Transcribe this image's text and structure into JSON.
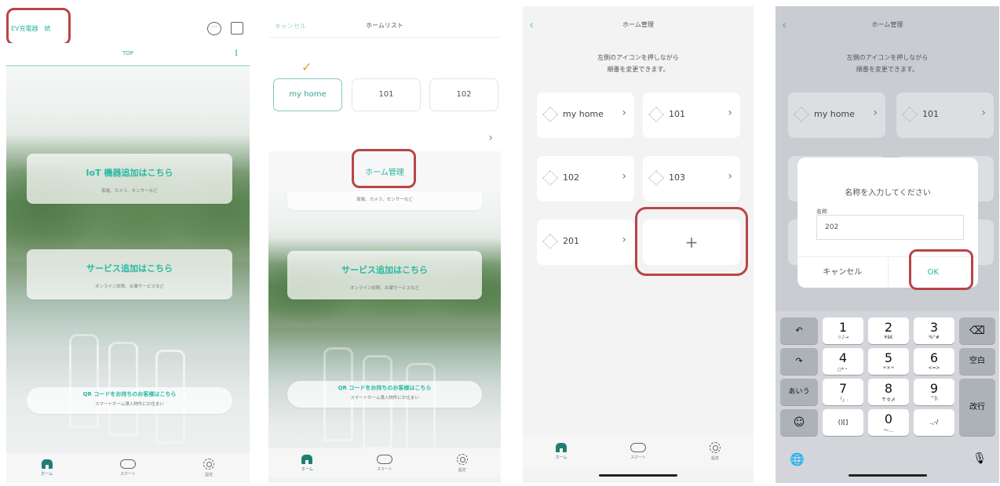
{
  "panel1": {
    "title": "EV充電器　統",
    "tab_top": "TOP",
    "card_iot": {
      "title": "IoT 機器追加はこちら",
      "sub": "家電、カメラ、センサーなど"
    },
    "card_service": {
      "title": "サービス追加はこちら",
      "sub": "オンライン診断、お薬サービスなど"
    },
    "card_qr": {
      "title": "QR コードをお持ちのお客様はこちら",
      "sub": "スマートホーム導入物件にお住まい"
    },
    "tabbar": [
      "ホーム",
      "スマート",
      "設定"
    ]
  },
  "panel2": {
    "cancel": "キャンセル",
    "title": "ホームリスト",
    "check": "✓",
    "homes": [
      "my home",
      "101",
      "102"
    ],
    "chevron": "›",
    "manage": "ホーム管理",
    "card_iot_sub": "家電、カメラ、センサーなど",
    "card_service": "サービス追加はこちら",
    "card_service_sub": "オンライン診断、お薬サービスなど",
    "card_qr": "QR コードをお持ちのお客様はこちら",
    "card_qr_sub": "スマートホーム導入物件にお住まい",
    "tabbar": [
      "ホーム",
      "スマート",
      "設定"
    ]
  },
  "panel3": {
    "back": "‹",
    "title": "ホーム管理",
    "hint_line1": "左側のアイコンを押しながら",
    "hint_line2": "順番を変更できます。",
    "homes": [
      "my home",
      "101",
      "102",
      "103",
      "201"
    ],
    "arrow": "›",
    "add": "+",
    "tabbar": [
      "ホーム",
      "スマート",
      "設定"
    ]
  },
  "panel4": {
    "back": "‹",
    "title": "ホーム管理",
    "hint_line1": "左側のアイコンを押しながら",
    "hint_line2": "順番を変更できます。",
    "homes": [
      "my home",
      "101"
    ],
    "arrow": "›",
    "dialog": {
      "question": "名称を入力してください",
      "field_label": "名称",
      "field_value": "202",
      "cancel": "キャンセル",
      "ok": "OK"
    },
    "keyboard": {
      "keys": [
        {
          "n": "1",
          "s": "☆♪→"
        },
        {
          "n": "2",
          "s": "¥$€"
        },
        {
          "n": "3",
          "s": "%°#"
        },
        {
          "n": "4",
          "s": "○*・"
        },
        {
          "n": "5",
          "s": "+×÷"
        },
        {
          "n": "6",
          "s": "<=>"
        },
        {
          "n": "7",
          "s": "「」:"
        },
        {
          "n": "8",
          "s": "〒々〆"
        },
        {
          "n": "9",
          "s": "^|\\"
        },
        {
          "n": "()[]",
          "s": ""
        },
        {
          "n": "0",
          "s": "〜…"
        },
        {
          "n": ".,-/",
          "s": ""
        }
      ],
      "undo": "↶",
      "redo": "↷",
      "aiu": "あいう",
      "emoji": "☺",
      "backspace": "⌫",
      "space": "空白",
      "enter": "改行",
      "globe": "🌐",
      "mic": "🎙"
    }
  },
  "colors": {
    "accent": "#2bb3a0",
    "highlight": "#b84547"
  }
}
